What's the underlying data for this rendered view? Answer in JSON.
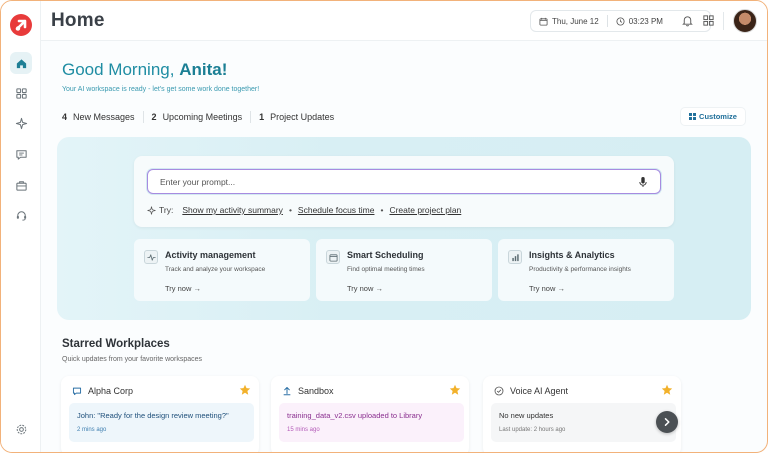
{
  "header": {
    "title": "Home",
    "date": "Thu, June 12",
    "time": "03:23 PM"
  },
  "sidebar": {
    "items": [
      {
        "name": "home",
        "icon": "home-icon",
        "active": true
      },
      {
        "name": "dashboard",
        "icon": "grid-icon",
        "active": false
      },
      {
        "name": "ai",
        "icon": "sparkle-icon",
        "active": false
      },
      {
        "name": "messages",
        "icon": "chat-icon",
        "active": false
      },
      {
        "name": "workspace",
        "icon": "briefcase-icon",
        "active": false
      },
      {
        "name": "support",
        "icon": "headset-icon",
        "active": false
      }
    ],
    "footer_icon": "gear-icon"
  },
  "greeting": {
    "prefix": "Good Morning,",
    "name": "Anita!",
    "subtitle": "Your AI workspace is ready - let's get some work done together!"
  },
  "stats": [
    {
      "count": "4",
      "label": "New Messages"
    },
    {
      "count": "2",
      "label": "Upcoming Meetings"
    },
    {
      "count": "1",
      "label": "Project Updates"
    }
  ],
  "customize_label": "Customize",
  "prompt": {
    "placeholder": "Enter your prompt...",
    "try_label": "Try:",
    "suggestions": [
      "Show my activity summary",
      "Schedule focus time",
      "Create project plan"
    ],
    "separator": "•"
  },
  "features": [
    {
      "title": "Activity management",
      "desc": "Track and analyze your workspace",
      "link": "Try now →",
      "icon": "activity-icon"
    },
    {
      "title": "Smart Scheduling",
      "desc": "Find optimal meeting times",
      "link": "Try now →",
      "icon": "calendar-icon"
    },
    {
      "title": "Insights & Analytics",
      "desc": "Productivity & performance insights",
      "link": "Try now →",
      "icon": "bar-chart-icon"
    }
  ],
  "starred": {
    "title": "Starred Workplaces",
    "subtitle": "Quick updates from your favorite workspaces",
    "cards": [
      {
        "name": "Alpha Corp",
        "icon": "chat-icon",
        "message": "John: \"Ready for the design review meeting?\"",
        "time": "2 mins ago",
        "tint": "#eef6fb",
        "text_color": "#1e4f7a",
        "time_color": "#3f7fb0"
      },
      {
        "name": "Sandbox",
        "icon": "upload-icon",
        "message": "training_data_v2.csv uploaded to Library",
        "time": "15 mins ago",
        "tint": "#fbf1fb",
        "text_color": "#8a2f8f",
        "time_color": "#b35ab8"
      },
      {
        "name": "Voice AI Agent",
        "icon": "check-circle-icon",
        "message": "No new updates",
        "time": "Last update: 2 hours ago",
        "tint": "#f5f6f7",
        "text_color": "#333333",
        "time_color": "#777777"
      }
    ]
  },
  "colors": {
    "accent": "#1f8da3",
    "brand": "#e83b3b",
    "star": "#f2b12b",
    "frame_border": "#f2b27a"
  }
}
